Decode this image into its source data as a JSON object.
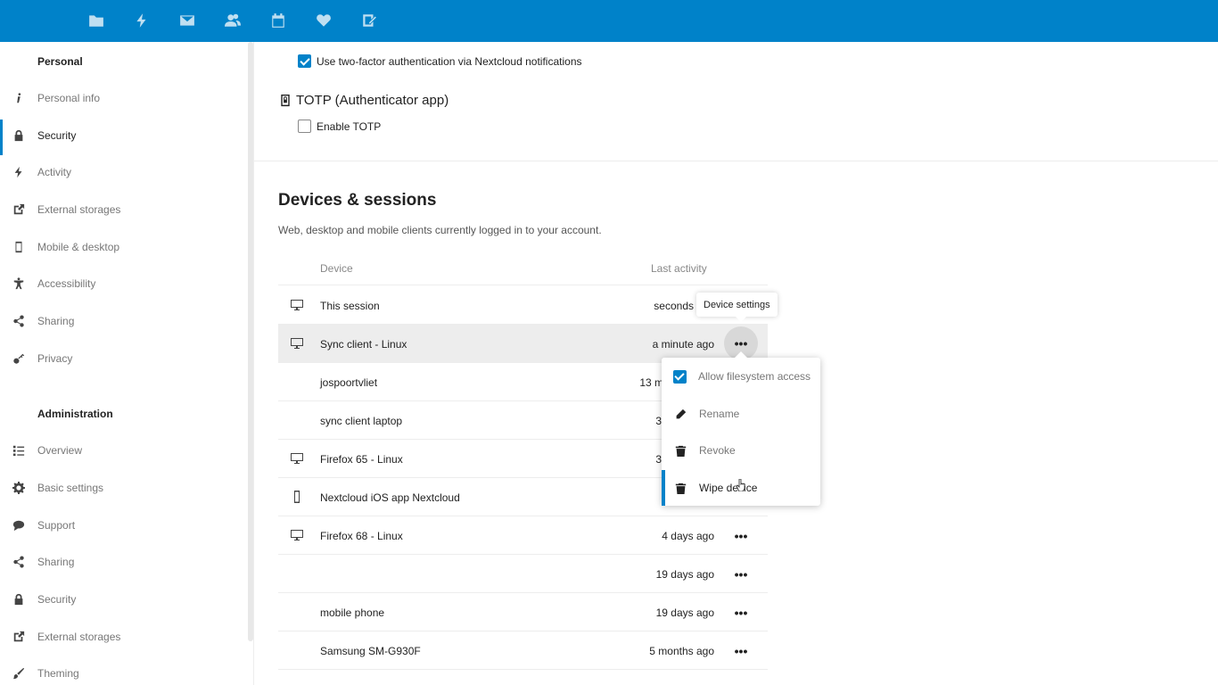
{
  "header": {
    "apps": [
      {
        "name": "files-icon"
      },
      {
        "name": "activity-icon"
      },
      {
        "name": "mail-icon"
      },
      {
        "name": "contacts-icon"
      },
      {
        "name": "calendar-icon"
      },
      {
        "name": "favorites-icon"
      },
      {
        "name": "notes-icon"
      }
    ]
  },
  "sidebar": {
    "personal_heading": "Personal",
    "personal_items": [
      {
        "label": "Personal info",
        "icon": "info-icon"
      },
      {
        "label": "Security",
        "icon": "lock-icon",
        "active": true
      },
      {
        "label": "Activity",
        "icon": "activity-icon"
      },
      {
        "label": "External storages",
        "icon": "external-link-icon"
      },
      {
        "label": "Mobile & desktop",
        "icon": "phone-icon"
      },
      {
        "label": "Accessibility",
        "icon": "accessibility-icon"
      },
      {
        "label": "Sharing",
        "icon": "share-icon"
      },
      {
        "label": "Privacy",
        "icon": "key-icon"
      }
    ],
    "admin_heading": "Administration",
    "admin_items": [
      {
        "label": "Overview",
        "icon": "list-icon"
      },
      {
        "label": "Basic settings",
        "icon": "gear-icon"
      },
      {
        "label": "Support",
        "icon": "speech-bubble-icon"
      },
      {
        "label": "Sharing",
        "icon": "share-icon"
      },
      {
        "label": "Security",
        "icon": "lock-icon"
      },
      {
        "label": "External storages",
        "icon": "external-link-icon"
      },
      {
        "label": "Theming",
        "icon": "brush-icon"
      }
    ]
  },
  "twofactor": {
    "notifications_label": "Use two-factor authentication via Nextcloud notifications",
    "notifications_checked": true,
    "totp_heading": "TOTP (Authenticator app)",
    "totp_label": "Enable TOTP",
    "totp_checked": false
  },
  "devices": {
    "title": "Devices & sessions",
    "description": "Web, desktop and mobile clients currently logged in to your account.",
    "col_device": "Device",
    "col_activity": "Last activity",
    "rows": [
      {
        "name": "This session",
        "activity": "seconds",
        "icon": "monitor-icon"
      },
      {
        "name": "Sync client - Linux",
        "activity": "a minute ago",
        "icon": "monitor-icon",
        "hover": true
      },
      {
        "name": "jospoortvliet",
        "activity": "13 m",
        "icon": ""
      },
      {
        "name": "sync client laptop",
        "activity": "3",
        "icon": ""
      },
      {
        "name": "Firefox 65 - Linux",
        "activity": "3",
        "icon": "monitor-icon"
      },
      {
        "name": "Nextcloud iOS app Nextcloud",
        "activity": "",
        "icon": "phone-icon"
      },
      {
        "name": "Firefox 68 - Linux",
        "activity": "4 days ago",
        "icon": "monitor-icon"
      },
      {
        "name": "",
        "activity": "19 days ago",
        "icon": ""
      },
      {
        "name": "mobile phone",
        "activity": "19 days ago",
        "icon": ""
      },
      {
        "name": "Samsung SM-G930F",
        "activity": "5 months ago",
        "icon": ""
      }
    ],
    "more_label": "•••"
  },
  "tooltip": "Device settings",
  "menu": {
    "items": [
      {
        "label": "Allow filesystem access",
        "type": "checkbox"
      },
      {
        "label": "Rename",
        "icon": "pencil-icon"
      },
      {
        "label": "Revoke",
        "icon": "trash-icon"
      },
      {
        "label": "Wipe device",
        "icon": "trash-icon",
        "active": true
      }
    ]
  }
}
